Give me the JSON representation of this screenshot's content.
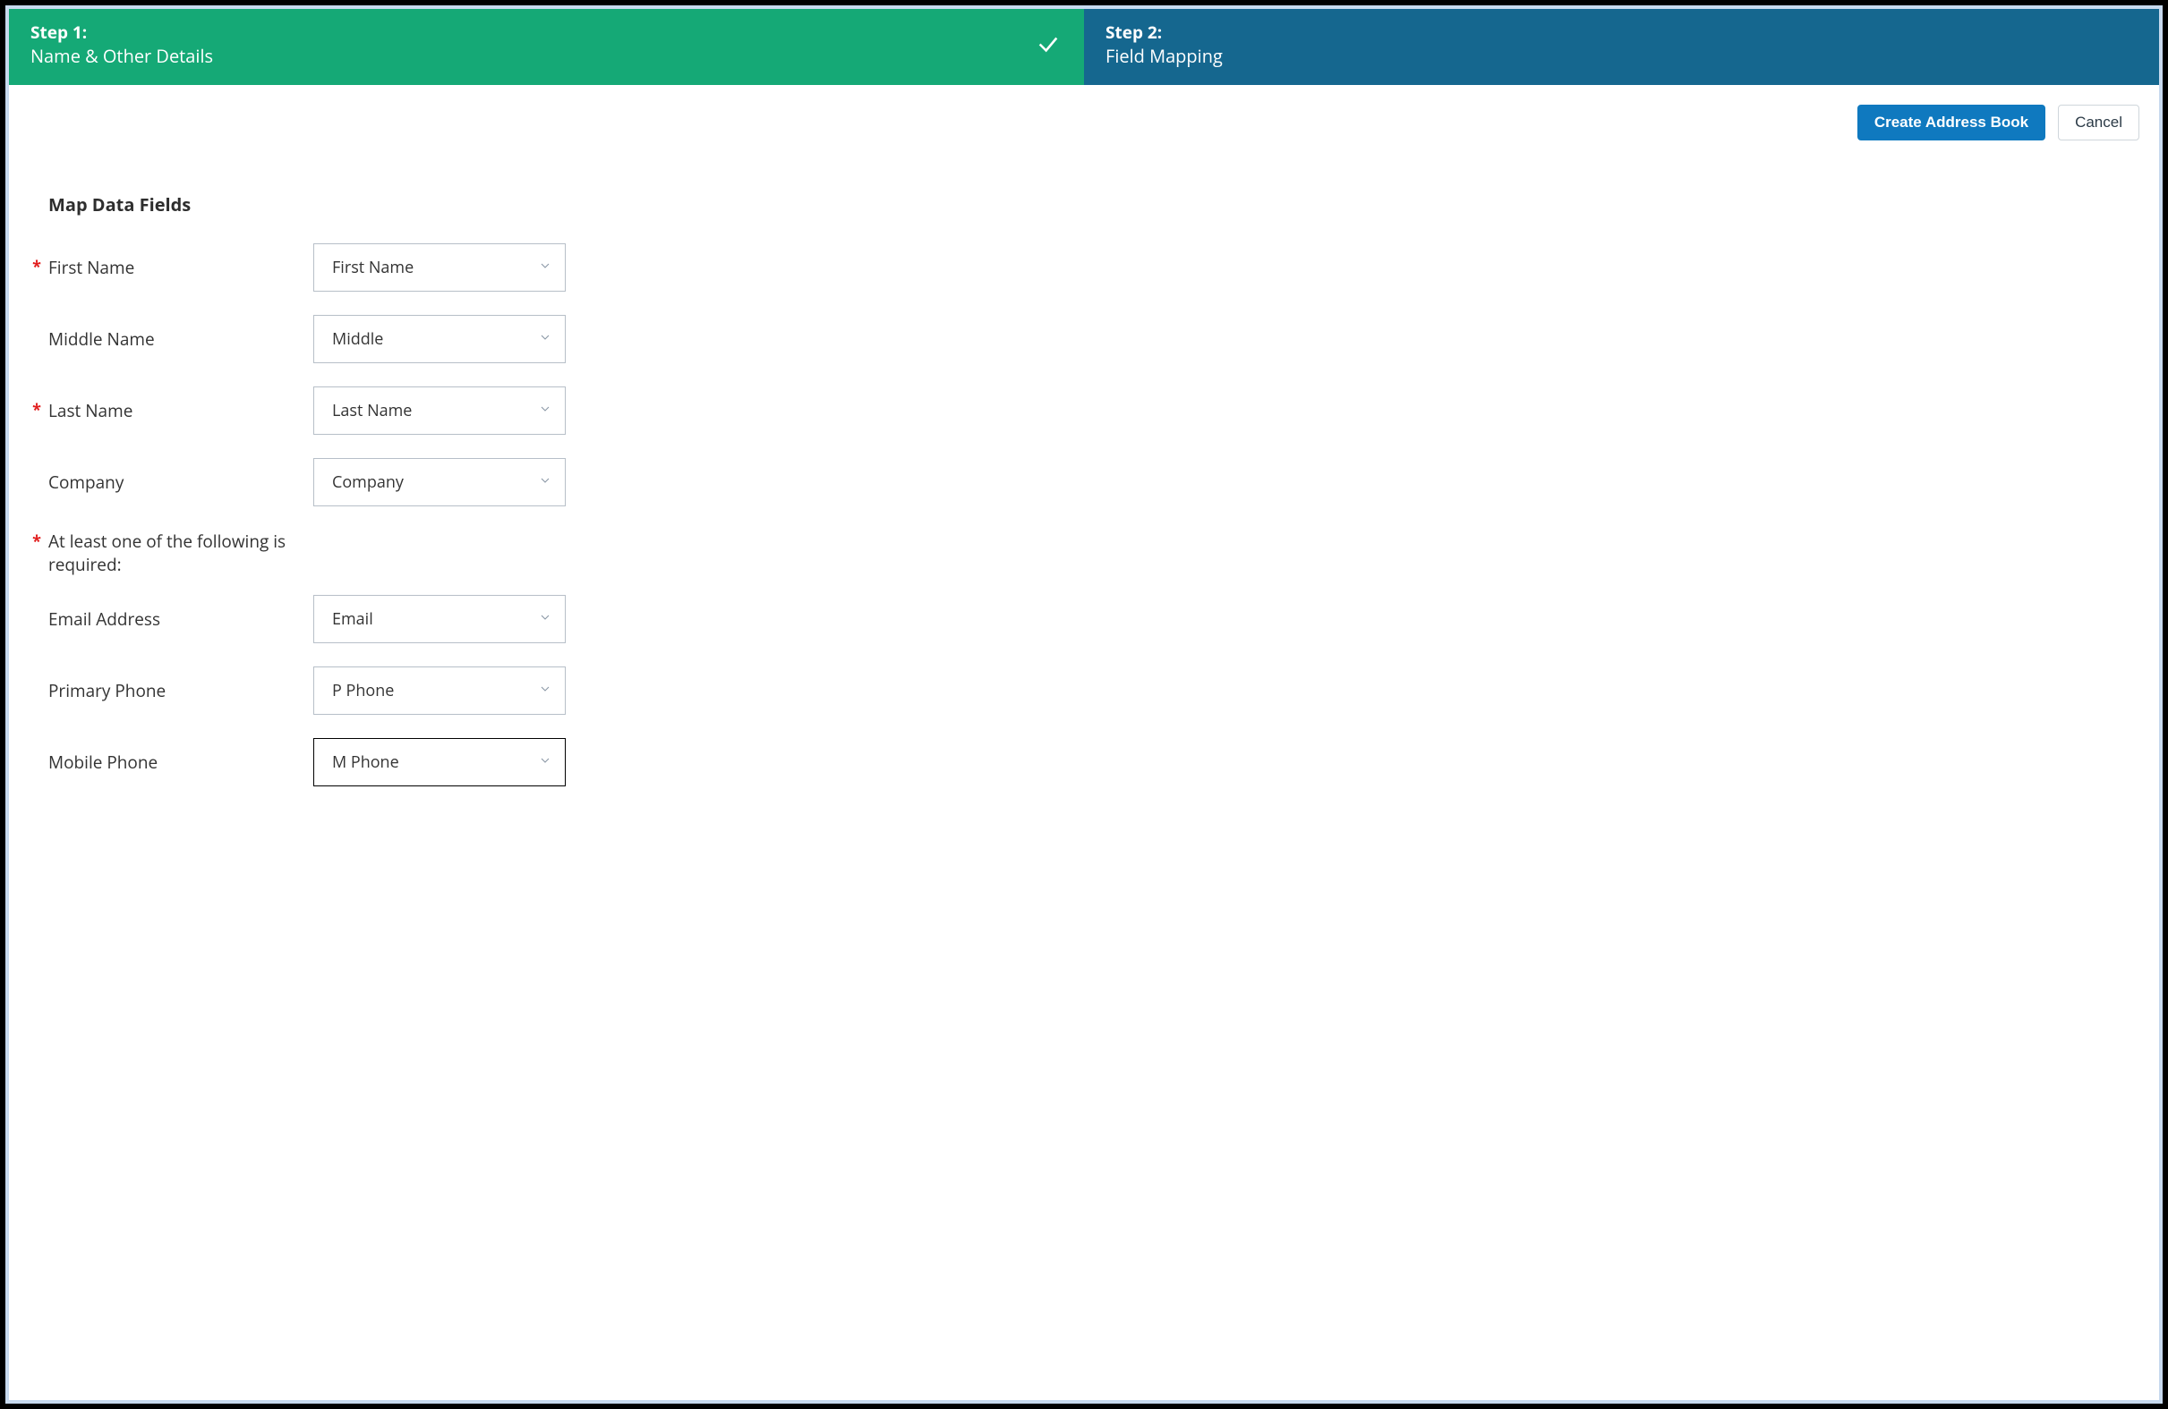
{
  "steps": {
    "step1": {
      "title": "Step 1:",
      "subtitle": "Name & Other Details"
    },
    "step2": {
      "title": "Step 2:",
      "subtitle": "Field Mapping"
    }
  },
  "actions": {
    "create": "Create Address Book",
    "cancel": "Cancel"
  },
  "section_title": "Map Data Fields",
  "required_marker": "*",
  "fields": {
    "first_name": {
      "label": "First Name",
      "value": "First Name"
    },
    "middle_name": {
      "label": "Middle Name",
      "value": "Middle"
    },
    "last_name": {
      "label": "Last Name",
      "value": "Last Name"
    },
    "company": {
      "label": "Company",
      "value": "Company"
    },
    "at_least_msg": "At least one of the following is required:",
    "email": {
      "label": "Email Address",
      "value": "Email"
    },
    "primary_phone": {
      "label": "Primary Phone",
      "value": "P Phone"
    },
    "mobile_phone": {
      "label": "Mobile Phone",
      "value": "M Phone"
    }
  }
}
